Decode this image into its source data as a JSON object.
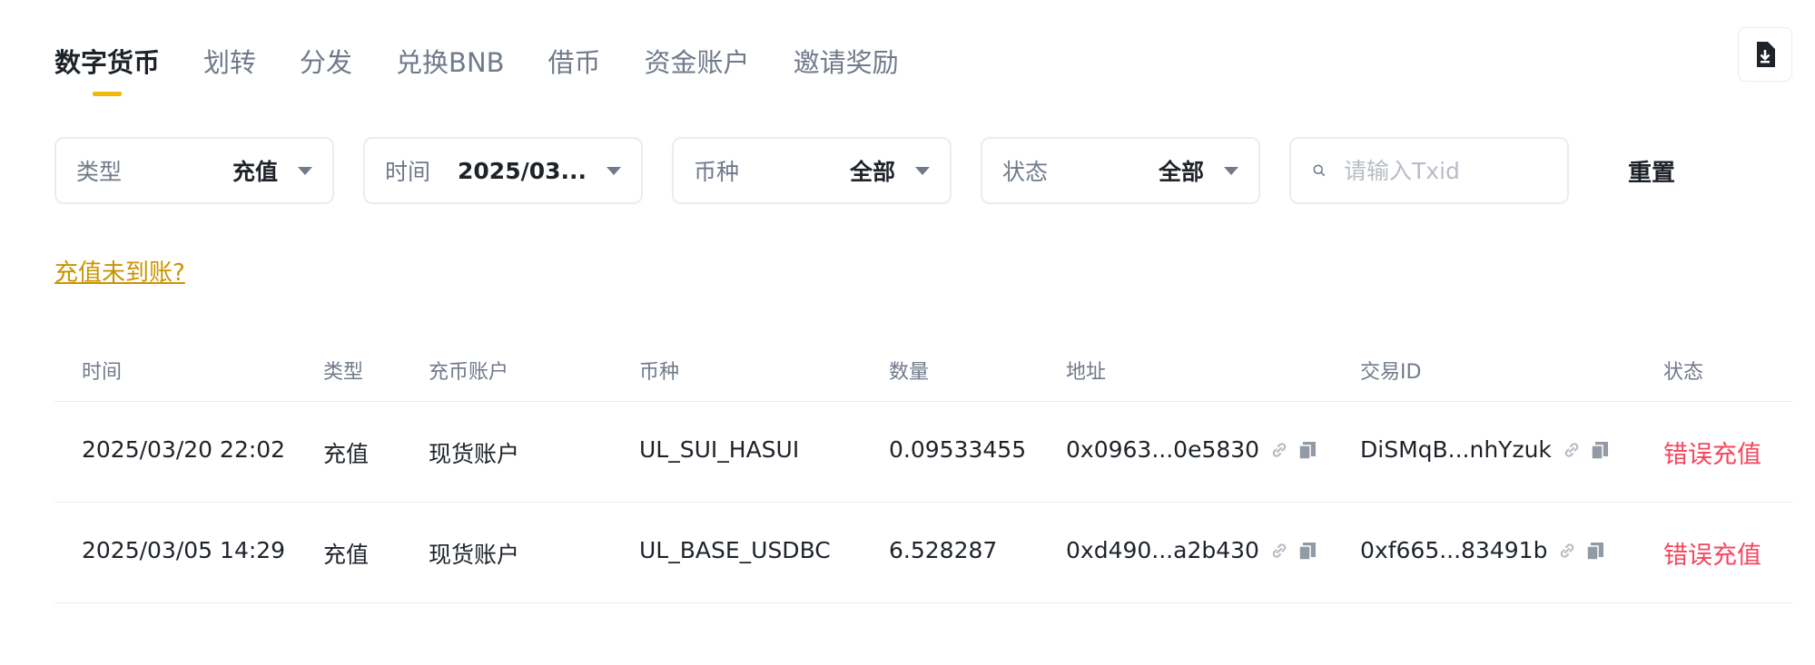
{
  "tabs": [
    {
      "label": "数字货币",
      "active": true
    },
    {
      "label": "划转"
    },
    {
      "label": "分发"
    },
    {
      "label": "兑换BNB"
    },
    {
      "label": "借币"
    },
    {
      "label": "资金账户"
    },
    {
      "label": "邀请奖励"
    }
  ],
  "filters": {
    "type": {
      "label": "类型",
      "value": "充值"
    },
    "time": {
      "label": "时间",
      "value": "2025/03..."
    },
    "coin": {
      "label": "币种",
      "value": "全部"
    },
    "status": {
      "label": "状态",
      "value": "全部"
    },
    "search_placeholder": "请输入Txid",
    "reset_label": "重置"
  },
  "deposit_not_arrived": "充值未到账?",
  "table": {
    "headers": [
      "时间",
      "类型",
      "充币账户",
      "币种",
      "数量",
      "地址",
      "交易ID",
      "状态"
    ],
    "rows": [
      {
        "time": "2025/03/20 22:02",
        "type": "充值",
        "account": "现货账户",
        "coin": "UL_SUI_HASUI",
        "amount": "0.09533455",
        "address": "0x0963...0e5830",
        "txid": "DiSMqB...nhYzuk",
        "status": "错误充值"
      },
      {
        "time": "2025/03/05 14:29",
        "type": "充值",
        "account": "现货账户",
        "coin": "UL_BASE_USDBC",
        "amount": "6.528287",
        "address": "0xd490...a2b430",
        "txid": "0xf665...83491b",
        "status": "错误充值"
      }
    ]
  },
  "colors": {
    "accent": "#f0b90b",
    "link": "#c99400",
    "error": "#f6465d"
  }
}
